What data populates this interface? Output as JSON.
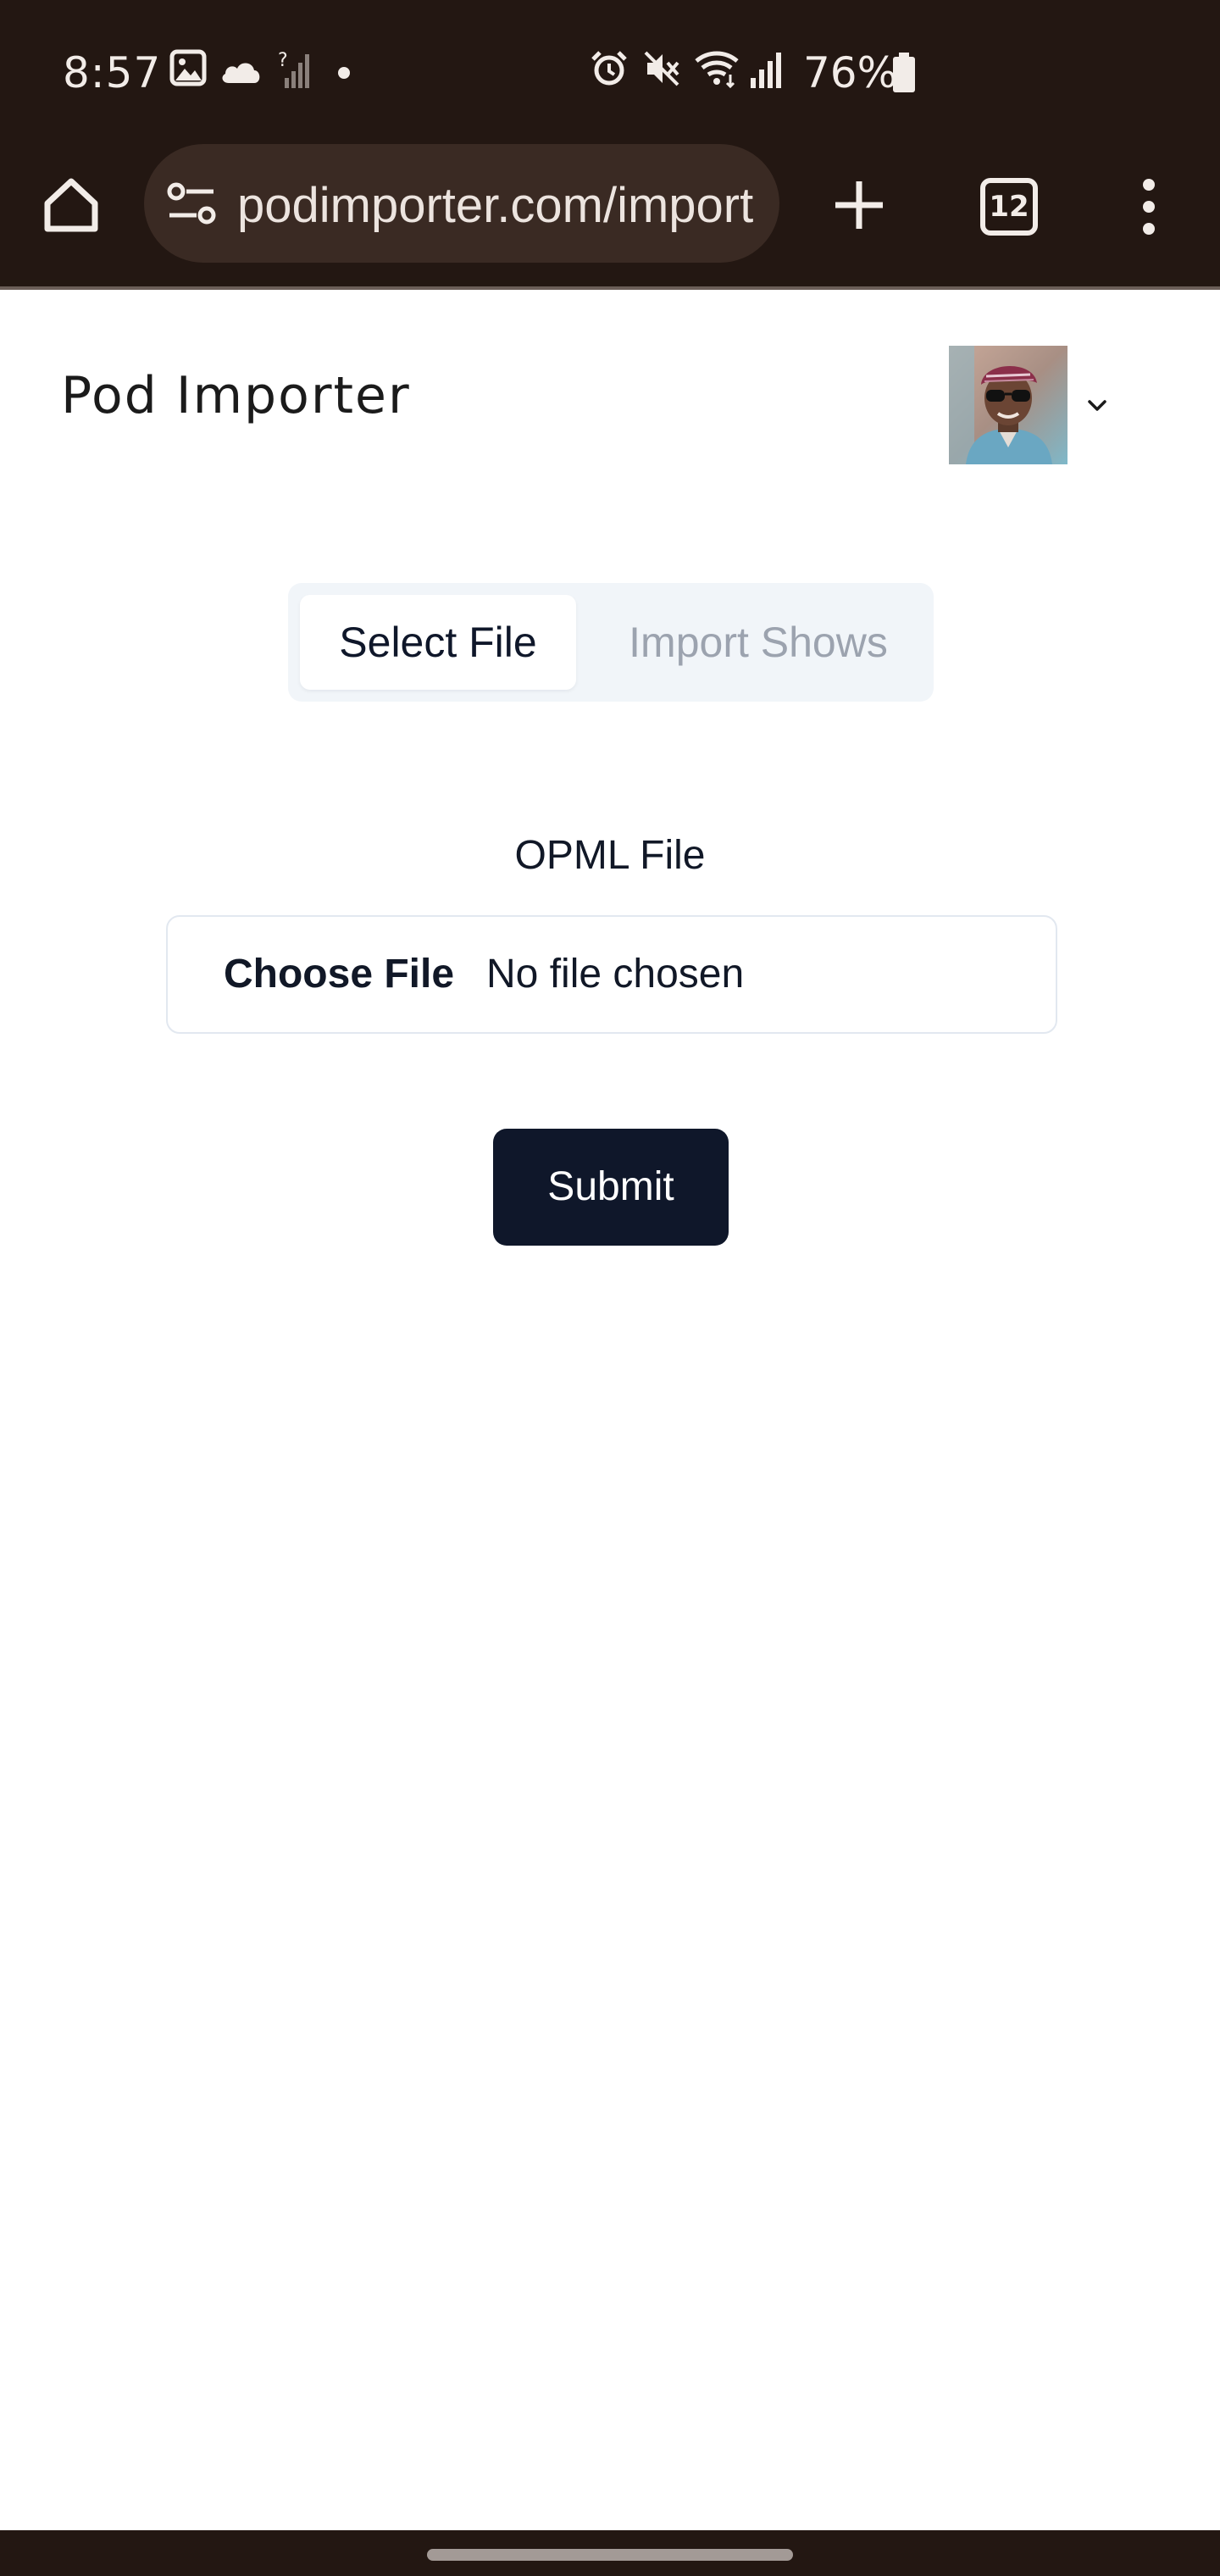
{
  "status_bar": {
    "time": "8:57",
    "battery": "76%",
    "icons": [
      "gallery-icon",
      "cloud-icon",
      "no-signal-icon",
      "dot-icon",
      "alarm-icon",
      "mute-icon",
      "wifi-icon",
      "signal-icon",
      "battery-icon"
    ]
  },
  "browser": {
    "url": "podimporter.com/import",
    "tab_count": "12",
    "icons": [
      "home-icon",
      "site-settings-icon",
      "new-tab-icon",
      "tab-switcher-icon",
      "more-menu-icon"
    ]
  },
  "header": {
    "title": "Pod Importer",
    "avatar": "user-avatar",
    "menu_icon": "chevron-down-icon"
  },
  "tabs": [
    {
      "label": "Select File",
      "active": true
    },
    {
      "label": "Import Shows",
      "active": false
    }
  ],
  "form": {
    "field_label": "OPML File",
    "choose_button": "Choose File",
    "file_status": "No file chosen",
    "submit_label": "Submit"
  },
  "colors": {
    "system_bar": "#231712",
    "url_pill": "#3a2a23",
    "primary_button": "#0f172a",
    "tab_track": "#f1f5f9",
    "tab_inactive_text": "#9ca3af",
    "input_border": "#e2e8f0"
  }
}
